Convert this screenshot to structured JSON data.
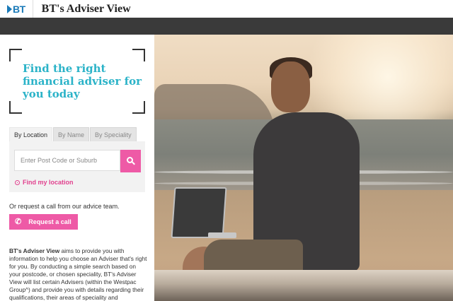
{
  "header": {
    "logo_text": "BT",
    "site_title": "BT's Adviser View"
  },
  "finder": {
    "title": "Find the right financial adviser for you today",
    "tabs": [
      {
        "label": "By Location",
        "active": true
      },
      {
        "label": "By Name",
        "active": false
      },
      {
        "label": "By Speciality",
        "active": false
      }
    ],
    "search": {
      "placeholder": "Enter Post Code or Suburb",
      "value": ""
    },
    "find_my_location": "Find my location"
  },
  "callback": {
    "prompt": "Or request a call from our advice team.",
    "button_label": "Request a call"
  },
  "about": {
    "brand": "BT's Adviser View",
    "text": " aims to provide you with information to help you choose an Adviser that's right for you. By conducting a simple search based on your postcode, or chosen speciality, BT's Adviser View will list certain Advisers (within the Westpac Group^) and provide you with details regarding their qualifications, their areas of speciality and"
  },
  "colors": {
    "brand_blue": "#1a7ab8",
    "accent_teal": "#2bb3c8",
    "accent_pink": "#ee5aa6",
    "nav_dark": "#3a3a3a"
  },
  "icons": {
    "search_button": "magnifier",
    "find_location": "target",
    "call_button": "phone"
  }
}
